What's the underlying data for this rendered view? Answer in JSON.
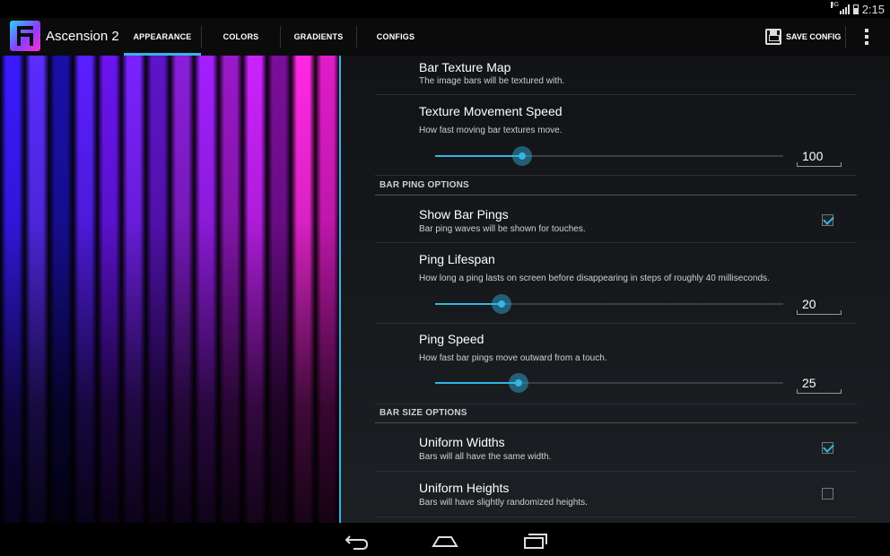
{
  "status_bar": {
    "network": "3G",
    "time": "2:15"
  },
  "action_bar": {
    "app_title": "Ascension 2",
    "tabs": [
      "APPEARANCE",
      "COLORS",
      "GRADIENTS",
      "CONFIGS"
    ],
    "active_tab": "APPEARANCE",
    "save_label": "SAVE CONFIG",
    "accent_color": "#33b5e5"
  },
  "preview": {
    "bar_colors": [
      "#3a1aff",
      "#5a2cff",
      "#1a0fa8",
      "#5a1fff",
      "#6a14f0",
      "#7a22ff",
      "#5f14c8",
      "#8a1eda",
      "#a31fff",
      "#9a18c8",
      "#cc22ff",
      "#7a0f9a",
      "#ff28e4",
      "#e01cc8"
    ]
  },
  "settings": {
    "bar_texture_map": {
      "title": "Bar Texture Map",
      "summary": "The image bars will be textured with."
    },
    "texture_movement_speed": {
      "title": "Texture Movement Speed",
      "summary": "How fast moving bar textures move.",
      "value": "100",
      "slider_fraction": 0.25
    },
    "section_bar_ping": "BAR PING OPTIONS",
    "show_bar_pings": {
      "title": "Show Bar Pings",
      "summary": "Bar ping waves will be shown for touches.",
      "checked": true
    },
    "ping_lifespan": {
      "title": "Ping Lifespan",
      "summary": "How long a ping lasts on screen before disappearing in steps of roughly 40 milliseconds.",
      "value": "20",
      "slider_fraction": 0.19
    },
    "ping_speed": {
      "title": "Ping Speed",
      "summary": "How fast bar pings move outward from a touch.",
      "value": "25",
      "slider_fraction": 0.24
    },
    "section_bar_size": "BAR SIZE OPTIONS",
    "uniform_widths": {
      "title": "Uniform Widths",
      "summary": "Bars will all have the same width.",
      "checked": true
    },
    "uniform_heights": {
      "title": "Uniform Heights",
      "summary": "Bars will have slightly randomized heights.",
      "checked": false
    }
  }
}
